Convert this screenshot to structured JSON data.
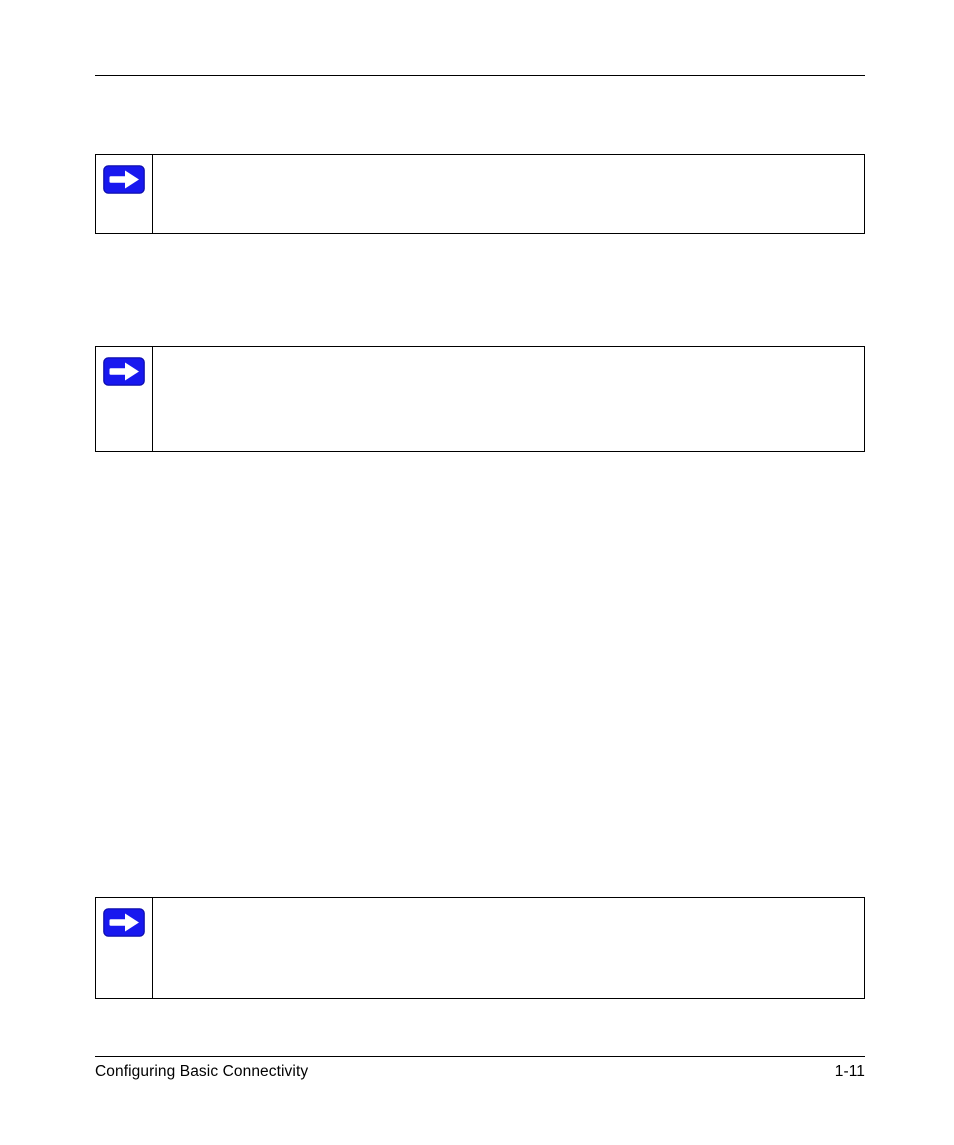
{
  "footer": {
    "left_text": "Configuring Basic Connectivity",
    "page_number": "1-11"
  },
  "notes": [
    {
      "kind": "note",
      "icon": "arrow-right-icon",
      "text": ""
    },
    {
      "kind": "note",
      "icon": "arrow-right-icon",
      "text": ""
    },
    {
      "kind": "note",
      "icon": "arrow-right-icon",
      "text": ""
    }
  ],
  "icons": {
    "arrow_right": "arrow-right-icon"
  }
}
